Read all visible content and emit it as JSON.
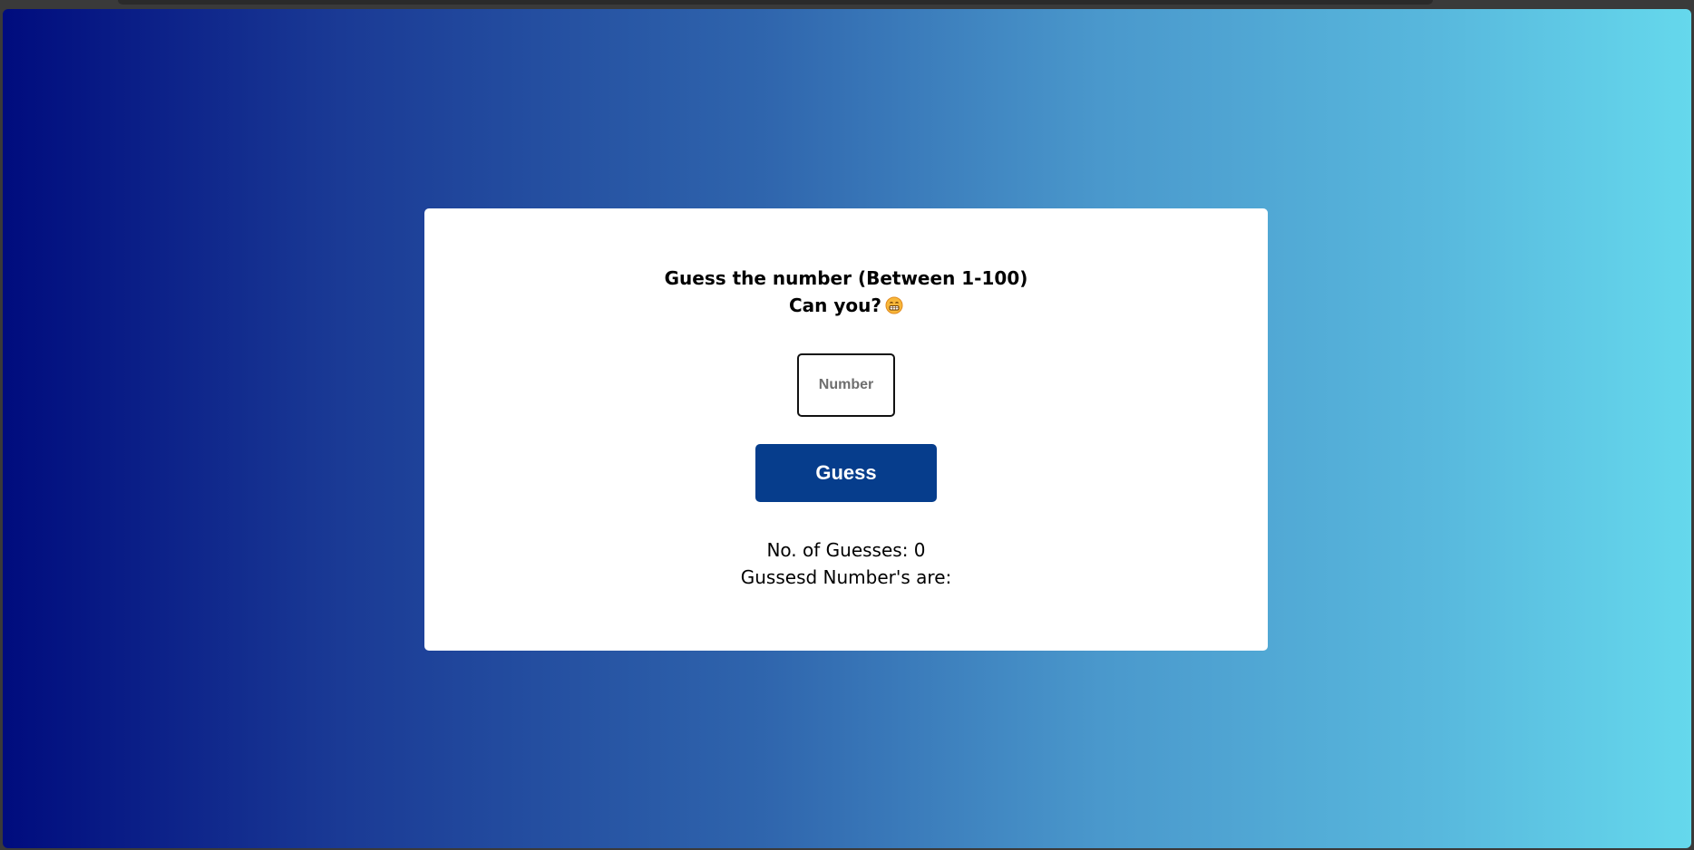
{
  "game": {
    "title_line1": "Guess the number (Between 1-100)",
    "title_line2": "Can you?",
    "emoji": "grinning-face-icon",
    "input": {
      "placeholder": "Number",
      "value": ""
    },
    "guess_button_label": "Guess",
    "guesses_label": "No. of Guesses: ",
    "guesses_count": "0",
    "guessed_numbers_label": "Gussesd Number's are:",
    "guessed_numbers": ""
  },
  "colors": {
    "gradient_start": "#000c7e",
    "gradient_end": "#65d8ec",
    "button_bg": "#063d8c",
    "card_bg": "#ffffff"
  }
}
